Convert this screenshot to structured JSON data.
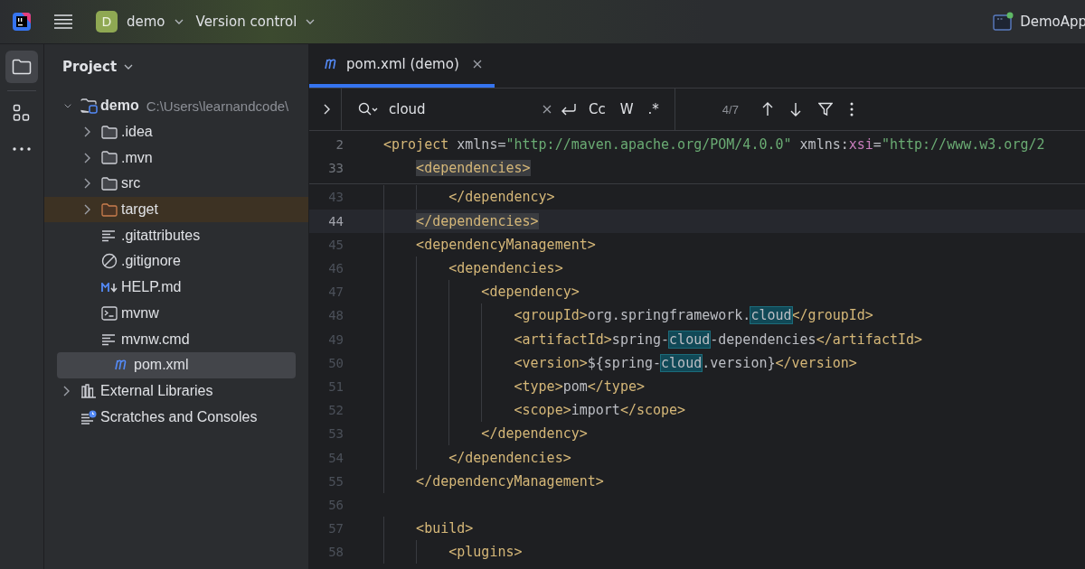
{
  "toolbar": {
    "project_badge": "D",
    "project_name": "demo",
    "vcs_menu": "Version control",
    "run_config": "DemoApp"
  },
  "project_panel": {
    "title": "Project",
    "tree": [
      {
        "label": "demo",
        "path": "C:\\Users\\learnandcode\\",
        "kind": "module",
        "expanded": true,
        "selected": false,
        "excluded": false,
        "children": [
          {
            "label": ".idea",
            "kind": "folder",
            "expanded": false,
            "selected": false,
            "excluded": false
          },
          {
            "label": ".mvn",
            "kind": "folder",
            "expanded": false,
            "selected": false,
            "excluded": false
          },
          {
            "label": "src",
            "kind": "folder",
            "expanded": false,
            "selected": false,
            "excluded": false
          },
          {
            "label": "target",
            "kind": "folder",
            "expanded": false,
            "selected": false,
            "excluded": true
          },
          {
            "label": ".gitattributes",
            "kind": "text",
            "selected": false,
            "excluded": false
          },
          {
            "label": ".gitignore",
            "kind": "ignore",
            "selected": false,
            "excluded": false
          },
          {
            "label": "HELP.md",
            "kind": "markdown",
            "selected": false,
            "excluded": false
          },
          {
            "label": "mvnw",
            "kind": "terminal",
            "selected": false,
            "excluded": false
          },
          {
            "label": "mvnw.cmd",
            "kind": "text",
            "selected": false,
            "excluded": false
          },
          {
            "label": "pom.xml",
            "kind": "maven",
            "selected": true,
            "excluded": false
          }
        ]
      },
      {
        "label": "External Libraries",
        "kind": "libraries",
        "expanded": false,
        "selected": false,
        "excluded": false
      },
      {
        "label": "Scratches and Consoles",
        "kind": "scratches",
        "selected": false,
        "excluded": false
      }
    ]
  },
  "tabs": [
    {
      "label": "pom.xml (demo)",
      "selected": true
    }
  ],
  "find_bar": {
    "value": "cloud",
    "match_case": false,
    "words": false,
    "regex": false,
    "toggle_labels": [
      "Cc",
      "W",
      ".*"
    ],
    "count": "4/7"
  },
  "sticky_lines": [
    {
      "number": "2",
      "tokens": [
        {
          "kind": "tag",
          "text": "<project"
        },
        {
          "kind": "attr",
          "text": " xmlns="
        },
        {
          "kind": "str",
          "text": "\"http://maven.apache.org/POM/4.0.0\""
        },
        {
          "kind": "attr",
          "text": " xmlns:"
        },
        {
          "kind": "ns",
          "text": "xsi"
        },
        {
          "kind": "attr",
          "text": "="
        },
        {
          "kind": "str",
          "text": "\"http://www.w3.org/2"
        }
      ]
    },
    {
      "number": "33",
      "tokens": [
        {
          "kind": "paired",
          "text": "    <dependencies>"
        }
      ]
    }
  ],
  "lines": [
    {
      "number": "43",
      "current": false,
      "tokens": [
        {
          "kind": "tag",
          "text": "        </dependency>"
        }
      ]
    },
    {
      "number": "44",
      "current": true,
      "tokens": [
        {
          "kind": "paired",
          "text": "    </dependencies>"
        }
      ]
    },
    {
      "number": "45",
      "current": false,
      "tokens": [
        {
          "kind": "tag",
          "text": "    <dependencyManagement>"
        }
      ]
    },
    {
      "number": "46",
      "current": false,
      "tokens": [
        {
          "kind": "tag",
          "text": "        <dependencies>"
        }
      ]
    },
    {
      "number": "47",
      "current": false,
      "tokens": [
        {
          "kind": "tag",
          "text": "            <dependency>"
        }
      ]
    },
    {
      "number": "48",
      "current": false,
      "tokens": [
        {
          "kind": "tag",
          "text": "                <groupId>"
        },
        {
          "kind": "text",
          "text": "org.springframework."
        },
        {
          "kind": "match",
          "text": "cloud"
        },
        {
          "kind": "tag",
          "text": "</groupId>"
        }
      ]
    },
    {
      "number": "49",
      "current": false,
      "tokens": [
        {
          "kind": "tag",
          "text": "                <artifactId>"
        },
        {
          "kind": "text",
          "text": "spring-"
        },
        {
          "kind": "match",
          "text": "cloud"
        },
        {
          "kind": "text",
          "text": "-dependencies"
        },
        {
          "kind": "tag",
          "text": "</artifactId>"
        }
      ]
    },
    {
      "number": "50",
      "current": false,
      "tokens": [
        {
          "kind": "tag",
          "text": "                <version>"
        },
        {
          "kind": "text",
          "text": "${spring-"
        },
        {
          "kind": "match",
          "text": "cloud"
        },
        {
          "kind": "text",
          "text": ".version}"
        },
        {
          "kind": "tag",
          "text": "</version>"
        }
      ]
    },
    {
      "number": "51",
      "current": false,
      "tokens": [
        {
          "kind": "tag",
          "text": "                <type>"
        },
        {
          "kind": "text",
          "text": "pom"
        },
        {
          "kind": "tag",
          "text": "</type>"
        }
      ]
    },
    {
      "number": "52",
      "current": false,
      "tokens": [
        {
          "kind": "tag",
          "text": "                <scope>"
        },
        {
          "kind": "text",
          "text": "import"
        },
        {
          "kind": "tag",
          "text": "</scope>"
        }
      ]
    },
    {
      "number": "53",
      "current": false,
      "tokens": [
        {
          "kind": "tag",
          "text": "            </dependency>"
        }
      ]
    },
    {
      "number": "54",
      "current": false,
      "tokens": [
        {
          "kind": "tag",
          "text": "        </dependencies>"
        }
      ]
    },
    {
      "number": "55",
      "current": false,
      "tokens": [
        {
          "kind": "tag",
          "text": "    </dependencyManagement>"
        }
      ]
    },
    {
      "number": "56",
      "current": false
    },
    {
      "number": "57",
      "current": false,
      "tokens": [
        {
          "kind": "tag",
          "text": "    <build>"
        }
      ]
    },
    {
      "number": "58",
      "current": false,
      "tokens": [
        {
          "kind": "tag",
          "text": "        <plugins>"
        }
      ]
    }
  ]
}
